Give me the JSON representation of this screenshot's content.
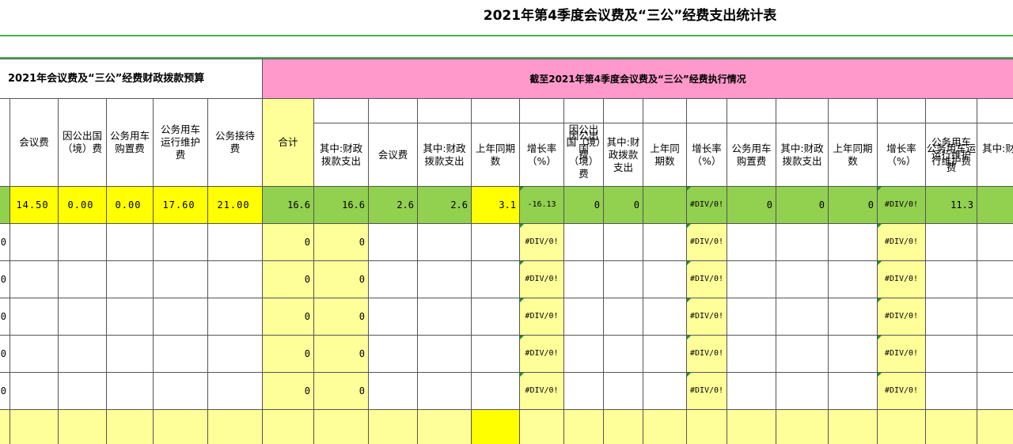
{
  "title": "2021年第4季度会议费及“三公”经费支出统计表",
  "colors": {
    "pink": "#ff99cc",
    "yellow": "#ffff00",
    "pale_yellow": "#ffff99",
    "green": "#92d050",
    "rule": "#4caf50"
  },
  "section_budget": "2021年会议费及“三公”经费财政拨款预算",
  "section_exec": "截至2021年第4季度会议费及“三公”经费执行情况",
  "headers": {
    "c1": "会议费",
    "c2": "因公出国（境）费",
    "c3": "公务用车购置费",
    "c4": "公务用车运行维护费",
    "c5": "公务接待费",
    "c6": "合计",
    "c7": "其中:财政拨款支出",
    "c8": "会议费",
    "c9": "其中:财政拨款支出",
    "c10": "上年同期数",
    "c11": "增长率（%）",
    "c12": "因公出国（境）费",
    "c13": "其中:财政拨款支出",
    "c14": "上年同期数",
    "c15": "增长率（%）",
    "c16": "公务用车购置费",
    "c17": "其中:财政拨款支出",
    "c18": "上年同期数",
    "c19": "增长率（%）",
    "c20": "公务用车运行维护费",
    "c21": "其中:财政拨款支出"
  },
  "summary_row": {
    "c1": "14.50",
    "c2": "0.00",
    "c3": "0.00",
    "c4": "17.60",
    "c5": "21.00",
    "c6": "16.6",
    "c7": "16.6",
    "c8": "2.6",
    "c9": "2.6",
    "c10": "3.1",
    "c11": "-16.13",
    "c12": "0",
    "c13": "0",
    "c14": "",
    "c15": "#DIV/0!",
    "c16": "0",
    "c17": "0",
    "c18": "0",
    "c19": "#DIV/0!",
    "c20": "11.3",
    "c21": ""
  },
  "data_rows": [
    {
      "c0": "0",
      "c6": "0",
      "c7": "0",
      "c11": "#DIV/0!",
      "c15": "#DIV/0!",
      "c19": "#DIV/0!"
    },
    {
      "c0": "0",
      "c6": "0",
      "c7": "0",
      "c11": "#DIV/0!",
      "c15": "#DIV/0!",
      "c19": "#DIV/0!"
    },
    {
      "c0": "0",
      "c6": "0",
      "c7": "0",
      "c11": "#DIV/0!",
      "c15": "#DIV/0!",
      "c19": "#DIV/0!"
    },
    {
      "c0": "0",
      "c6": "0",
      "c7": "0",
      "c11": "#DIV/0!",
      "c15": "#DIV/0!",
      "c19": "#DIV/0!"
    },
    {
      "c0": "0",
      "c6": "0",
      "c7": "0",
      "c11": "#DIV/0!",
      "c15": "#DIV/0!",
      "c19": "#DIV/0!"
    }
  ]
}
